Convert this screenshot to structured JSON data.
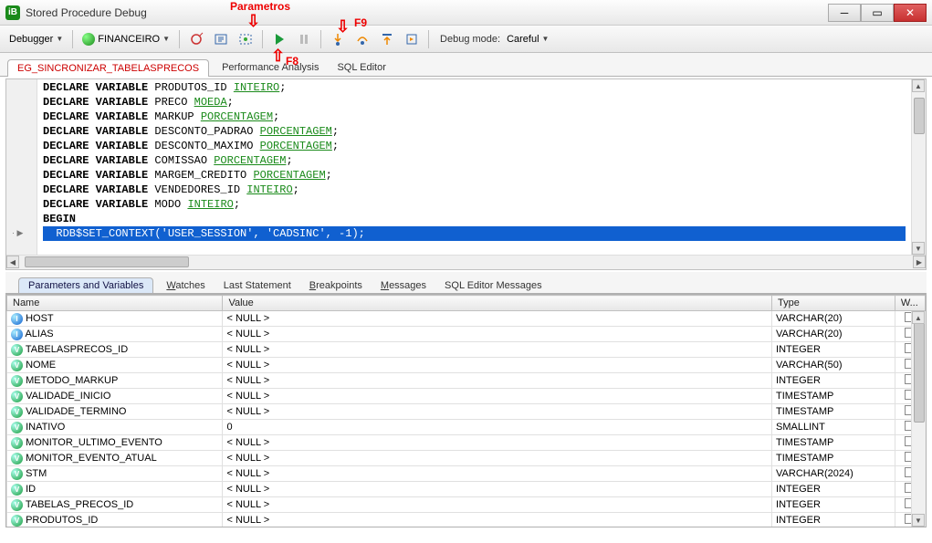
{
  "window": {
    "title": "Stored Procedure Debug"
  },
  "annotations": {
    "parametros": "Parametros",
    "f9": "F9",
    "f8": "F8"
  },
  "toolbar": {
    "debugger_label": "Debugger",
    "db_label": "FINANCEIRO",
    "debug_mode_label": "Debug mode:",
    "debug_mode_value": "Careful"
  },
  "editor_tabs": {
    "active": "EG_SINCRONIZAR_TABELASPRECOS",
    "perf": "Performance Analysis",
    "sql": "SQL Editor"
  },
  "code": {
    "lines": [
      {
        "pre": "DECLARE VARIABLE PRODUTOS_ID ",
        "type": "INTEIRO",
        "post": ";"
      },
      {
        "pre": "DECLARE VARIABLE PRECO ",
        "type": "MOEDA",
        "post": ";"
      },
      {
        "pre": "DECLARE VARIABLE MARKUP ",
        "type": "PORCENTAGEM",
        "post": ";"
      },
      {
        "pre": "DECLARE VARIABLE DESCONTO_PADRAO ",
        "type": "PORCENTAGEM",
        "post": ";"
      },
      {
        "pre": "DECLARE VARIABLE DESCONTO_MAXIMO ",
        "type": "PORCENTAGEM",
        "post": ";"
      },
      {
        "pre": "DECLARE VARIABLE COMISSAO ",
        "type": "PORCENTAGEM",
        "post": ";"
      },
      {
        "pre": "DECLARE VARIABLE MARGEM_CREDITO ",
        "type": "PORCENTAGEM",
        "post": ";"
      },
      {
        "pre": "DECLARE VARIABLE VENDEDORES_ID ",
        "type": "INTEIRO",
        "post": ";"
      },
      {
        "pre": "DECLARE VARIABLE MODO ",
        "type": "INTEIRO",
        "post": ";"
      },
      {
        "pre": "BEGIN",
        "type": "",
        "post": ""
      }
    ],
    "hl_line": "  RDB$SET_CONTEXT('USER_SESSION', 'CADSINC', -1);"
  },
  "bottom_tabs": {
    "params": "Parameters and Variables",
    "watches": "Watches",
    "last": "Last Statement",
    "bp": "Breakpoints",
    "msg": "Messages",
    "sqlmsg": "SQL Editor Messages"
  },
  "grid": {
    "headers": {
      "name": "Name",
      "value": "Value",
      "type": "Type",
      "w": "W..."
    },
    "rows": [
      {
        "icon": "in",
        "name": "HOST",
        "value": "< NULL >",
        "type": "VARCHAR(20)"
      },
      {
        "icon": "in",
        "name": "ALIAS",
        "value": "< NULL >",
        "type": "VARCHAR(20)"
      },
      {
        "icon": "v",
        "name": "TABELASPRECOS_ID",
        "value": "< NULL >",
        "type": "INTEGER"
      },
      {
        "icon": "v",
        "name": "NOME",
        "value": "< NULL >",
        "type": "VARCHAR(50)"
      },
      {
        "icon": "v",
        "name": "METODO_MARKUP",
        "value": "< NULL >",
        "type": "INTEGER"
      },
      {
        "icon": "v",
        "name": "VALIDADE_INICIO",
        "value": "< NULL >",
        "type": "TIMESTAMP"
      },
      {
        "icon": "v",
        "name": "VALIDADE_TERMINO",
        "value": "< NULL >",
        "type": "TIMESTAMP"
      },
      {
        "icon": "v",
        "name": "INATIVO",
        "value": "0",
        "type": "SMALLINT"
      },
      {
        "icon": "v",
        "name": "MONITOR_ULTIMO_EVENTO",
        "value": "< NULL >",
        "type": "TIMESTAMP"
      },
      {
        "icon": "v",
        "name": "MONITOR_EVENTO_ATUAL",
        "value": "< NULL >",
        "type": "TIMESTAMP"
      },
      {
        "icon": "v",
        "name": "STM",
        "value": "< NULL >",
        "type": "VARCHAR(2024)"
      },
      {
        "icon": "v",
        "name": "ID",
        "value": "< NULL >",
        "type": "INTEGER"
      },
      {
        "icon": "v",
        "name": "TABELAS_PRECOS_ID",
        "value": "< NULL >",
        "type": "INTEGER"
      },
      {
        "icon": "v",
        "name": "PRODUTOS_ID",
        "value": "< NULL >",
        "type": "INTEGER"
      }
    ]
  }
}
